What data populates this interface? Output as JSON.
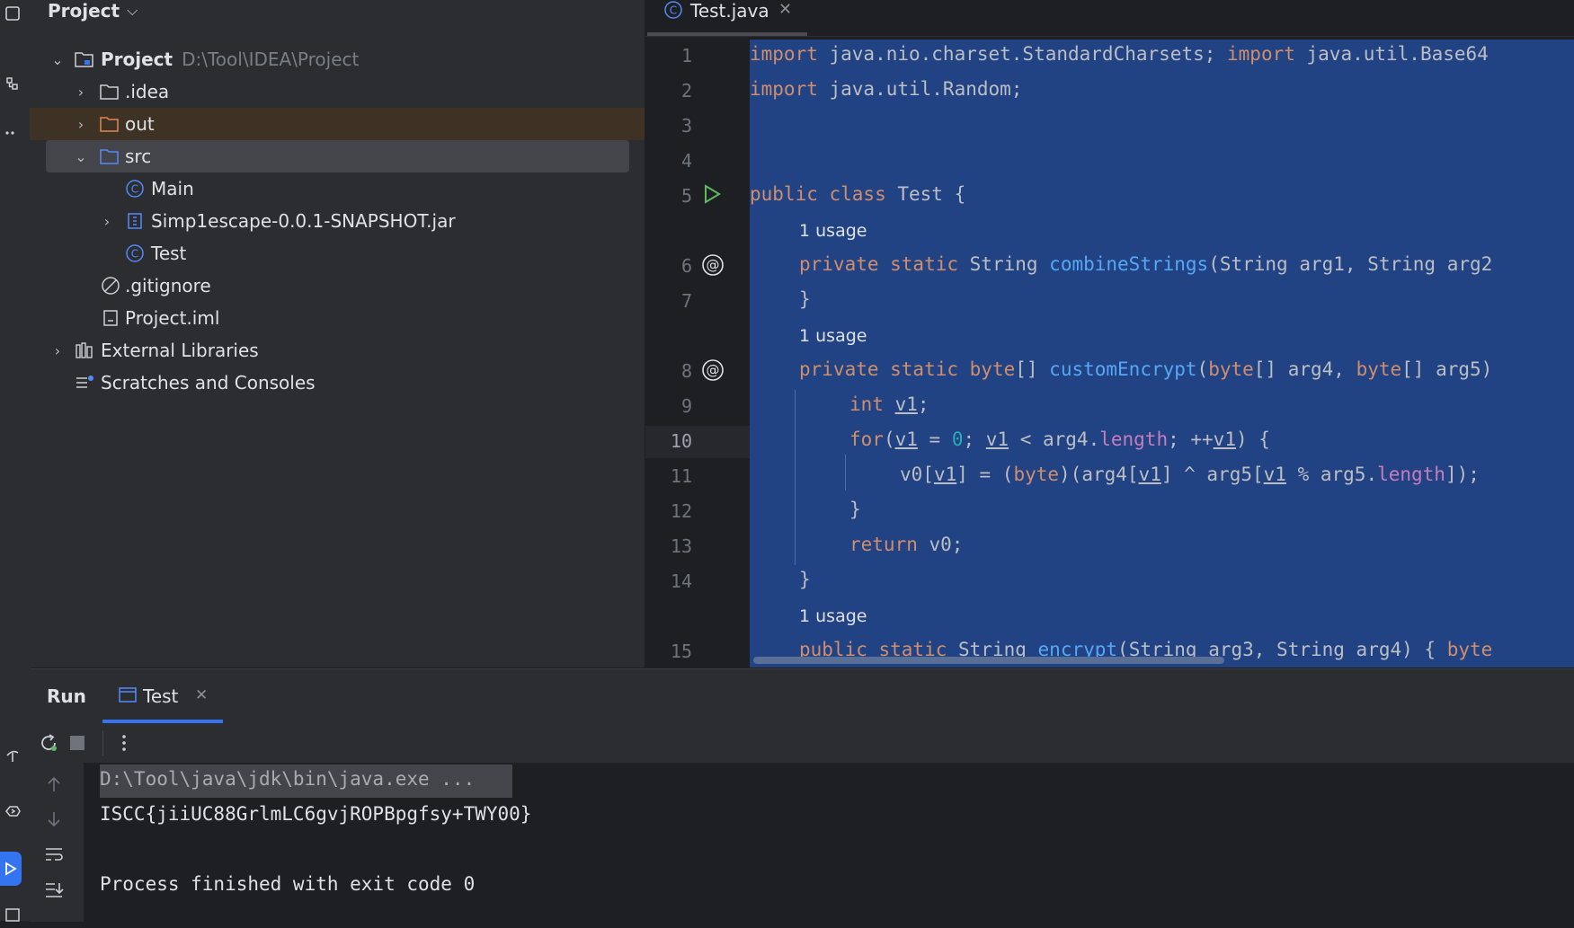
{
  "project_panel": {
    "title": "Project",
    "tree": [
      {
        "label": "Project",
        "hint": "D:\\Tool\\IDEA\\Project",
        "icon": "folder-module-icon"
      },
      {
        "label": ".idea",
        "icon": "folder-icon"
      },
      {
        "label": "out",
        "icon": "folder-orange-icon"
      },
      {
        "label": "src",
        "icon": "folder-source-icon"
      },
      {
        "label": "Main",
        "icon": "java-class-icon"
      },
      {
        "label": "Simp1escape-0.0.1-SNAPSHOT.jar",
        "icon": "jar-icon"
      },
      {
        "label": "Test",
        "icon": "java-class-icon"
      },
      {
        "label": ".gitignore",
        "icon": "ignore-file-icon"
      },
      {
        "label": "Project.iml",
        "icon": "iml-file-icon"
      },
      {
        "label": "External Libraries",
        "icon": "libraries-icon"
      },
      {
        "label": "Scratches and Consoles",
        "icon": "scratches-icon"
      }
    ]
  },
  "editor": {
    "tab_label": "Test.java",
    "line_numbers": [
      "1",
      "2",
      "3",
      "4",
      "5",
      "6",
      "7",
      "8",
      "9",
      "10",
      "11",
      "12",
      "13",
      "14",
      "15"
    ],
    "current_line": "10",
    "usage_label": "1 usage",
    "code": {
      "l1a": "import",
      "l1b": " java.nio.charset.StandardCharsets; ",
      "l1c": "import",
      "l1d": " java.util.Base64",
      "l2a": "import",
      "l2b": " java.util.Random;",
      "l5a": "public class",
      "l5b": " Test {",
      "l6a": "private static",
      "l6b": " String ",
      "l6c": "combineStrings",
      "l6d": "(String arg1, String arg2",
      "brace": "}",
      "l8a": "private static",
      "l8b": " byte",
      "l8c": "[] ",
      "l8d": "customEncrypt",
      "l8e": "(",
      "l8f": "byte",
      "l8g": "[] arg4, ",
      "l8h": "byte",
      "l8i": "[] arg5)",
      "l9a": "int",
      "v1": "v1",
      "l9c": ";",
      "l10a": "for",
      "l10b": "(",
      "l10c": " = ",
      "zero": "0",
      "l10d": "; ",
      "l10e": " < arg4.",
      "length": "length",
      "l10f": "; ++",
      "l10g": ") {",
      "l11a": "v0[",
      "l11b": "] = (",
      "byte_kw": "byte",
      "l11c": ")(arg4[",
      "l11d": "] ^ arg5[",
      "l11e": " % arg5.",
      "l11f": "]);",
      "l13a": "return",
      "l13b": " v0;",
      "l15a": "public static",
      "l15b": " String ",
      "l15c": "encrypt",
      "l15d": "(String arg3, String arg4) { ",
      "l15e": "byte"
    }
  },
  "run_panel": {
    "title": "Run",
    "tab_label": "Test",
    "console": [
      "D:\\Tool\\java\\jdk\\bin\\java.exe ...",
      "ISCC{jiiUC88GrlmLC6gvjROPBpgfsy+TWY00}",
      "",
      "Process finished with exit code 0"
    ]
  },
  "colors": {
    "selection": "#214283",
    "keyword": "#cf8e6d",
    "method": "#56a8f5",
    "number": "#2aacb8",
    "field": "#c77dbb",
    "accent": "#3574f0",
    "out_folder_bg": "#3d3223"
  }
}
